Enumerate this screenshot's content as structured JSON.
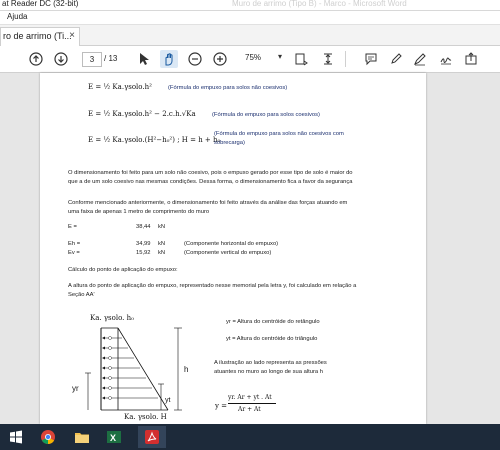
{
  "titlebar": {
    "app": "at Reader DC (32-bit)",
    "doc": "Muro de arrimo (Tipo B) - Marco - Microsoft Word"
  },
  "menubar": {
    "help": "Ajuda"
  },
  "tab": {
    "label": "ro de arrimo (Ti...",
    "close": "×"
  },
  "toolbar": {
    "page_current": "3",
    "page_total": "/ 13",
    "zoom": "75%"
  },
  "document": {
    "f1": "E = ½ Ka.γsolo.h²",
    "f1_note": "(Fórmula do empuxo para solos não coesivos)",
    "f2": "E = ½ Ka.γsolo.h² − 2.c.h.√Ka",
    "f2_note": "(Fórmula do empuxo para solos coesivos)",
    "f3": "E = ½ Ka.γsolo.(H²−h₀²) ;  H = h + h₀",
    "f3_note_1": "(Fórmula do empuxo para solos não coesivos com",
    "f3_note_2": "sobrecarga)",
    "p1_line1": "O dimensionamento foi feito para um solo não coesivo, pois o empuxo gerado por esse tipo de solo é maior do",
    "p1_line2": "que a de um solo coesivo nas mesmas condições. Dessa forma, o dimensionamento fica a favor da segurança",
    "p2_line1": "Conforme mencionado anteriormente, o dimensionamento foi feito através da análise das forças atuando em",
    "p2_line2": "uma faixa de apenas 1 metro de comprimento do muro",
    "rows": [
      {
        "label": "E =",
        "value": "38,44",
        "unit": "kN",
        "note": ""
      },
      {
        "label": "Eh =",
        "value": "34,99",
        "unit": "kN",
        "note": "(Componente horizontal do empuxo)"
      },
      {
        "label": "Ev =",
        "value": "15,92",
        "unit": "kN",
        "note": "(Componente vertical do empuxo)"
      }
    ],
    "heading_calc": "Cálculo do ponto de aplicação do empuxo:",
    "p3_line1": "A altura do ponto de aplicação do empuxo, representado nesse memorial pela letra y, foi calculado em relação a",
    "p3_line2": "Seção AA'",
    "fig": {
      "top_label": "Ka. γsolo. h₀",
      "bottom_label": "Ka. γsolo. H",
      "h_label": "h",
      "yr_label": "yr",
      "yt_label": "yt"
    },
    "legend_yr": "yr = Altura do centróide do retângulo",
    "legend_yt": "yt = Altura do centróide do triângulo",
    "illus_line1": "A ilustração ao lado representa as pressões",
    "illus_line2": "atuantes no muro ao longo de sua altura h",
    "y_formula_lhs": "y =",
    "y_formula_num": "yr. Ar + yt . At",
    "y_formula_den": "Ar + At"
  },
  "taskbar": {
    "items": [
      "windows-start",
      "file-explorer",
      "chrome",
      "folder",
      "excel",
      "acrobat"
    ]
  }
}
